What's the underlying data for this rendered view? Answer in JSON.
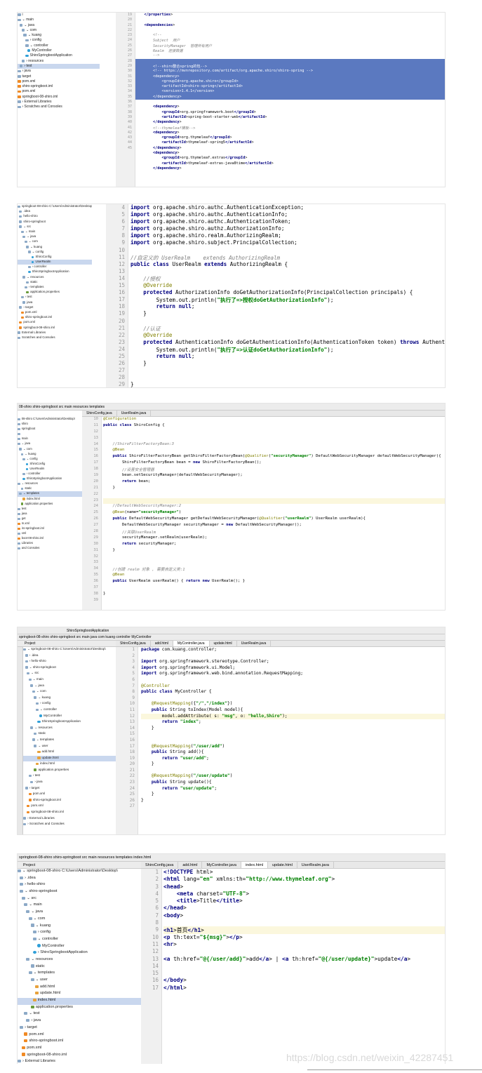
{
  "colors": {
    "keyword": "#000080",
    "string": "#008000",
    "comment": "#808080",
    "annotation": "#808000",
    "tag": "#000080",
    "field": "#660e7a",
    "selection": "#5b79c0"
  },
  "watermark": "https://blog.csdn.net/weixin_42287451",
  "s1": {
    "tree": [
      "i",
      "⌄ main",
      "  ⌄ java",
      "    ⌄ com",
      "      ⌄ kuang",
      "        › config",
      "        ⌄ controller",
      "          MyController",
      "        ShiroSpringbootApplication",
      "    › resources",
      "  › test",
      "› java",
      "target",
      "pom.xml",
      "shiro-springboot.iml",
      "pom.xml",
      "springboot-08-shiro.iml",
      "› External Libraries",
      "› Scratches and Consoles"
    ],
    "tree_sel": 10,
    "gutter": [
      "19",
      "20",
      "21",
      "22",
      "23",
      "24",
      "25",
      "26",
      "27",
      "28",
      "29",
      "30",
      "31",
      "32",
      "33",
      "34",
      "35",
      "36",
      "37",
      "38",
      "39",
      "40",
      "41",
      "42",
      "43",
      "44",
      "45"
    ],
    "code": [
      "    </properties>",
      "",
      "    <dependencies>",
      "",
      "        <!--",
      "        Subject  用户",
      "        SecurityManager  管理所有用户",
      "        Realm  连接数据",
      "        -->",
      "",
      "        <!--shiro整合spring的包-->",
      "        <!-- https://mvnrepository.com/artifact/org.apache.shiro/shiro-spring -->",
      "        <dependency>",
      "            <groupId>org.apache.shiro</groupId>",
      "            <artifactId>shiro-spring</artifactId>",
      "            <version>1.4.1</version>",
      "        </dependency>",
      "",
      "        <dependency>",
      "            <groupId>org.springframework.boot</groupId>",
      "            <artifactId>spring-boot-starter-web</artifactId>",
      "        </dependency>",
      "        <!--thymeleaf模板-->",
      "        <dependency>",
      "            <groupId>org.thymeleaf</groupId>",
      "            <artifactId>thymeleaf-spring5</artifactId>",
      "        </dependency>",
      "        <dependency>",
      "            <groupId>org.thymeleaf.extras</groupId>",
      "            <artifactId>thymeleaf-extras-java8time</artifactId>",
      "        </dependency>"
    ],
    "hl": [
      9,
      10,
      11,
      12,
      13,
      14,
      15,
      16
    ]
  },
  "s2": {
    "tree": [
      "springboot-08-shiro C:\\Users\\Administrator\\Desktop",
      "  .idea",
      "  hello-shiro",
      "  shiro-springboot",
      "  ⌄ src",
      "    ⌄ main",
      "      ⌄ java",
      "        ⌄ com",
      "          ⌄ kuang",
      "            ⌄ config",
      "                ShiroConfig",
      "                UserRealm",
      "            › controller",
      "            ShiroSpringbootApplication",
      "      ⌄ resources",
      "          static",
      "        › templates",
      "          application.properties",
      "    › test",
      "      java",
      "  › target",
      "    pom.xml",
      "    shiro-springboot.iml",
      "  pom.xml",
      "  springboot-08-shiro.iml",
      "External Libraries",
      "Scratches and Consoles"
    ],
    "tree_sel": 11,
    "gutter": [
      "4",
      "5",
      "6",
      "7",
      "8",
      "9",
      "10",
      "11",
      "12",
      "13",
      "14",
      "15",
      "16",
      "17",
      "18",
      "19",
      "20",
      "21",
      "22",
      "23",
      "24",
      "25",
      "26",
      "27",
      "28",
      "29"
    ],
    "code": [
      "import org.apache.shiro.authc.AuthenticationException;",
      "import org.apache.shiro.authc.AuthenticationInfo;",
      "import org.apache.shiro.authc.AuthenticationToken;",
      "import org.apache.shiro.authz.AuthorizationInfo;",
      "import org.apache.shiro.realm.AuthorizingRealm;",
      "import org.apache.shiro.subject.PrincipalCollection;",
      "",
      "//自定义的 UserRealm    extends AuthorizingRealm",
      "public class UserRealm extends AuthorizingRealm {",
      "",
      "    //授权",
      "    @Override",
      "    protected AuthorizationInfo doGetAuthorizationInfo(PrincipalCollection principals) {",
      "        System.out.println(\"执行了=>授权doGetAuthorizationInfo\");",
      "        return null;",
      "    }",
      "",
      "    //认证",
      "    @Override",
      "    protected AuthenticationInfo doGetAuthenticationInfo(AuthenticationToken token) throws AuthenticationException",
      "        System.out.println(\"执行了=>认证doGetAuthorizationInfo\");",
      "        return null;",
      "    }",
      "",
      "",
      "}"
    ]
  },
  "s3": {
    "topbar": "08-shiro  shiro-springboot  src  main  resources  templates",
    "tabs": [
      "ShiroConfig.java",
      "UserRealm.java"
    ],
    "tree": [
      "08-shiro C:\\Users\\Administrator\\Desktop\\",
      "shiro",
      "springboot",
      "",
      "main",
      "⌄ java",
      "  ⌄ com",
      "    ⌄ kuang",
      "      ⌄ config",
      "          ShiroConfig",
      "          UserRealm",
      "      › controller",
      "      ShiroSpringbootApplication",
      "⌄ resources",
      "    static",
      "  ⌄ templates",
      "      index.html",
      "    application.properties",
      "test",
      "java",
      "get",
      "m.xml",
      "iro-springboot.iml",
      "xml",
      "boot-08-shiro.iml",
      "Libraries",
      "and Consoles"
    ],
    "tree_sel": 15,
    "gutter": [
      "10",
      "11",
      "12",
      "13",
      "14",
      "15",
      "16",
      "17",
      "18",
      "19",
      "20",
      "21",
      "22",
      "23",
      "24",
      "25",
      "26",
      "27",
      "28",
      "29",
      "30",
      "31",
      "32",
      "33",
      "34",
      "35",
      "36",
      "37",
      "38",
      "39"
    ],
    "code": [
      "@Configuration",
      "public class ShiroConfig {",
      "",
      "",
      "    //ShiroFilterFactoryBean:3",
      "    @Bean",
      "    public ShiroFilterFactoryBean getShiroFilterFactoryBean(@Qualifier(\"securityManager\") DefaultWebSecurityManager defaultWebSecurityManager){",
      "        ShiroFilterFactoryBean bean = new ShiroFilterFactoryBean();",
      "        //设置安全管理器",
      "        bean.setSecurityManager(defaultWebSecurityManager);",
      "        return bean;",
      "    }",
      "",
      "",
      "    //DefaultWebSecurityManager:2",
      "    @Bean(name=\"securityManager\")",
      "    public DefaultWebSecurityManager getDefaultWebSecurityManager(@Qualifier(\"userRealm\") UserRealm userRealm){",
      "        DefaultWebSecurityManager securityManager = new DefaultWebSecurityManager();",
      "        //关联UserRealm",
      "        securityManager.setRealm(userRealm);",
      "        return securityManager;",
      "    }",
      "",
      "",
      "    //创建 realm 对象 , 需要自定义类:1",
      "    @Bean",
      "    public UserRealm userRealm() { return new UserRealm(); }",
      "",
      "}",
      ""
    ],
    "cur": [
      13
    ]
  },
  "s4": {
    "toolbar": "ShiroSpringbootApplication",
    "nav": "springboot-08-shiro  shiro-springboot  src  main  java  com  kuang  controller  MyController",
    "project_label": "Project",
    "tabs": [
      "ShiroConfig.java",
      "add.html",
      "MyController.java",
      "update.html",
      "UserRealm.java"
    ],
    "tabs_active": 2,
    "side": "1: Project",
    "tree": [
      "⌄ springboot-08-shiro C:\\Users\\Administrator\\Desktop\\",
      "  › .idea",
      "  › hello-shiro",
      "  ⌄ shiro-springboot",
      "    ⌄ src",
      "      ⌄ main",
      "        ⌄ java",
      "          ⌄ com",
      "            ⌄ kuang",
      "              › config",
      "              ⌄ controller",
      "                  MyController",
      "                ShiroSpringbootApplication",
      "        ⌄ resources",
      "            static",
      "          ⌄ templates",
      "            ⌄ user",
      "                add.html",
      "                update.html",
      "              index.html",
      "            application.properties",
      "      › test",
      "        › java",
      "  › target",
      "      pom.xml",
      "      shiro-springboot.iml",
      "    pom.xml",
      "    springboot-08-shiro.iml",
      "› External Libraries",
      "› Scratches and Consoles"
    ],
    "tree_sel": 18,
    "gutter": [
      "1",
      "2",
      "3",
      "4",
      "5",
      "6",
      "7",
      "8",
      "9",
      "10",
      "11",
      "12",
      "13",
      "14",
      "15",
      "16",
      "17",
      "18",
      "19",
      "20",
      "21",
      "22",
      "23",
      "24",
      "25",
      "26",
      "27"
    ],
    "code": [
      "package com.kuang.controller;",
      "",
      "import org.springframework.stereotype.Controller;",
      "import org.springframework.ui.Model;",
      "import org.springframework.web.bind.annotation.RequestMapping;",
      "",
      "@Controller",
      "public class MyController {",
      "",
      "    @RequestMapping({\"/\",\"/index\"})",
      "    public String toIndex(Model model){",
      "        model.addAttribute( s: \"msg\", o: \"hello,Shiro\");",
      "        return \"index\";",
      "    }",
      "",
      "",
      "    @RequestMapping(\"/user/add\")",
      "    public String add(){",
      "        return \"user/add\";",
      "    }",
      "",
      "    @RequestMapping(\"/user/update\")",
      "    public String update(){",
      "        return \"user/update\";",
      "    }",
      "}",
      ""
    ],
    "cur": [
      11
    ]
  },
  "s5": {
    "nav": "springboot-08-shiro  shiro-springboot  src  main  resources  templates  index.html",
    "project_label": "Project",
    "tabs": [
      "ShiroConfig.java",
      "add.html",
      "MyController.java",
      "index.html",
      "update.html",
      "UserRealm.java"
    ],
    "tabs_active": 3,
    "tree": [
      "⌄ springboot-08-shiro C:\\Users\\Administrator\\Desktop\\",
      "  › .idea",
      "  › hello-shiro",
      "  ⌄ shiro-springboot",
      "    ⌄ src",
      "      ⌄ main",
      "        ⌄ java",
      "          ⌄ com",
      "            ⌄ kuang",
      "              › config",
      "              ⌄ controller",
      "                  MyController",
      "              › ShiroSpringbootApplication",
      "        ⌄ resources",
      "            static",
      "          ⌄ templates",
      "            ⌄ user",
      "                add.html",
      "                update.html",
      "              index.html",
      "            application.properties",
      "      ⌄ test",
      "        › java",
      "  › target",
      "      pom.xml",
      "      shiro-springboot.iml",
      "    pom.xml",
      "    springboot-08-shiro.iml",
      "› External Libraries"
    ],
    "tree_sel": 19,
    "gutter": [
      "1",
      "2",
      "3",
      "4",
      "5",
      "6",
      "7",
      "8",
      "9",
      "10",
      "11",
      "12",
      "13",
      "14",
      "15",
      "16",
      "17"
    ],
    "code": [
      "<!DOCTYPE html>",
      "<html lang=\"en\" xmlns:th=\"http://www.thymeleaf.org\">",
      "<head>",
      "    <meta charset=\"UTF-8\">",
      "    <title>Title</title>",
      "</head>",
      "<body>",
      "",
      "<h1>首页</h1>",
      "<p th:text=\"${msg}\"></p>",
      "<hr>",
      "",
      "<a th:href=\"@{/user/add}\">add</a> | <a th:href=\"@{/user/update}\">update</a>",
      "",
      "",
      "</body>",
      "</html>"
    ],
    "cur": [
      8
    ]
  }
}
